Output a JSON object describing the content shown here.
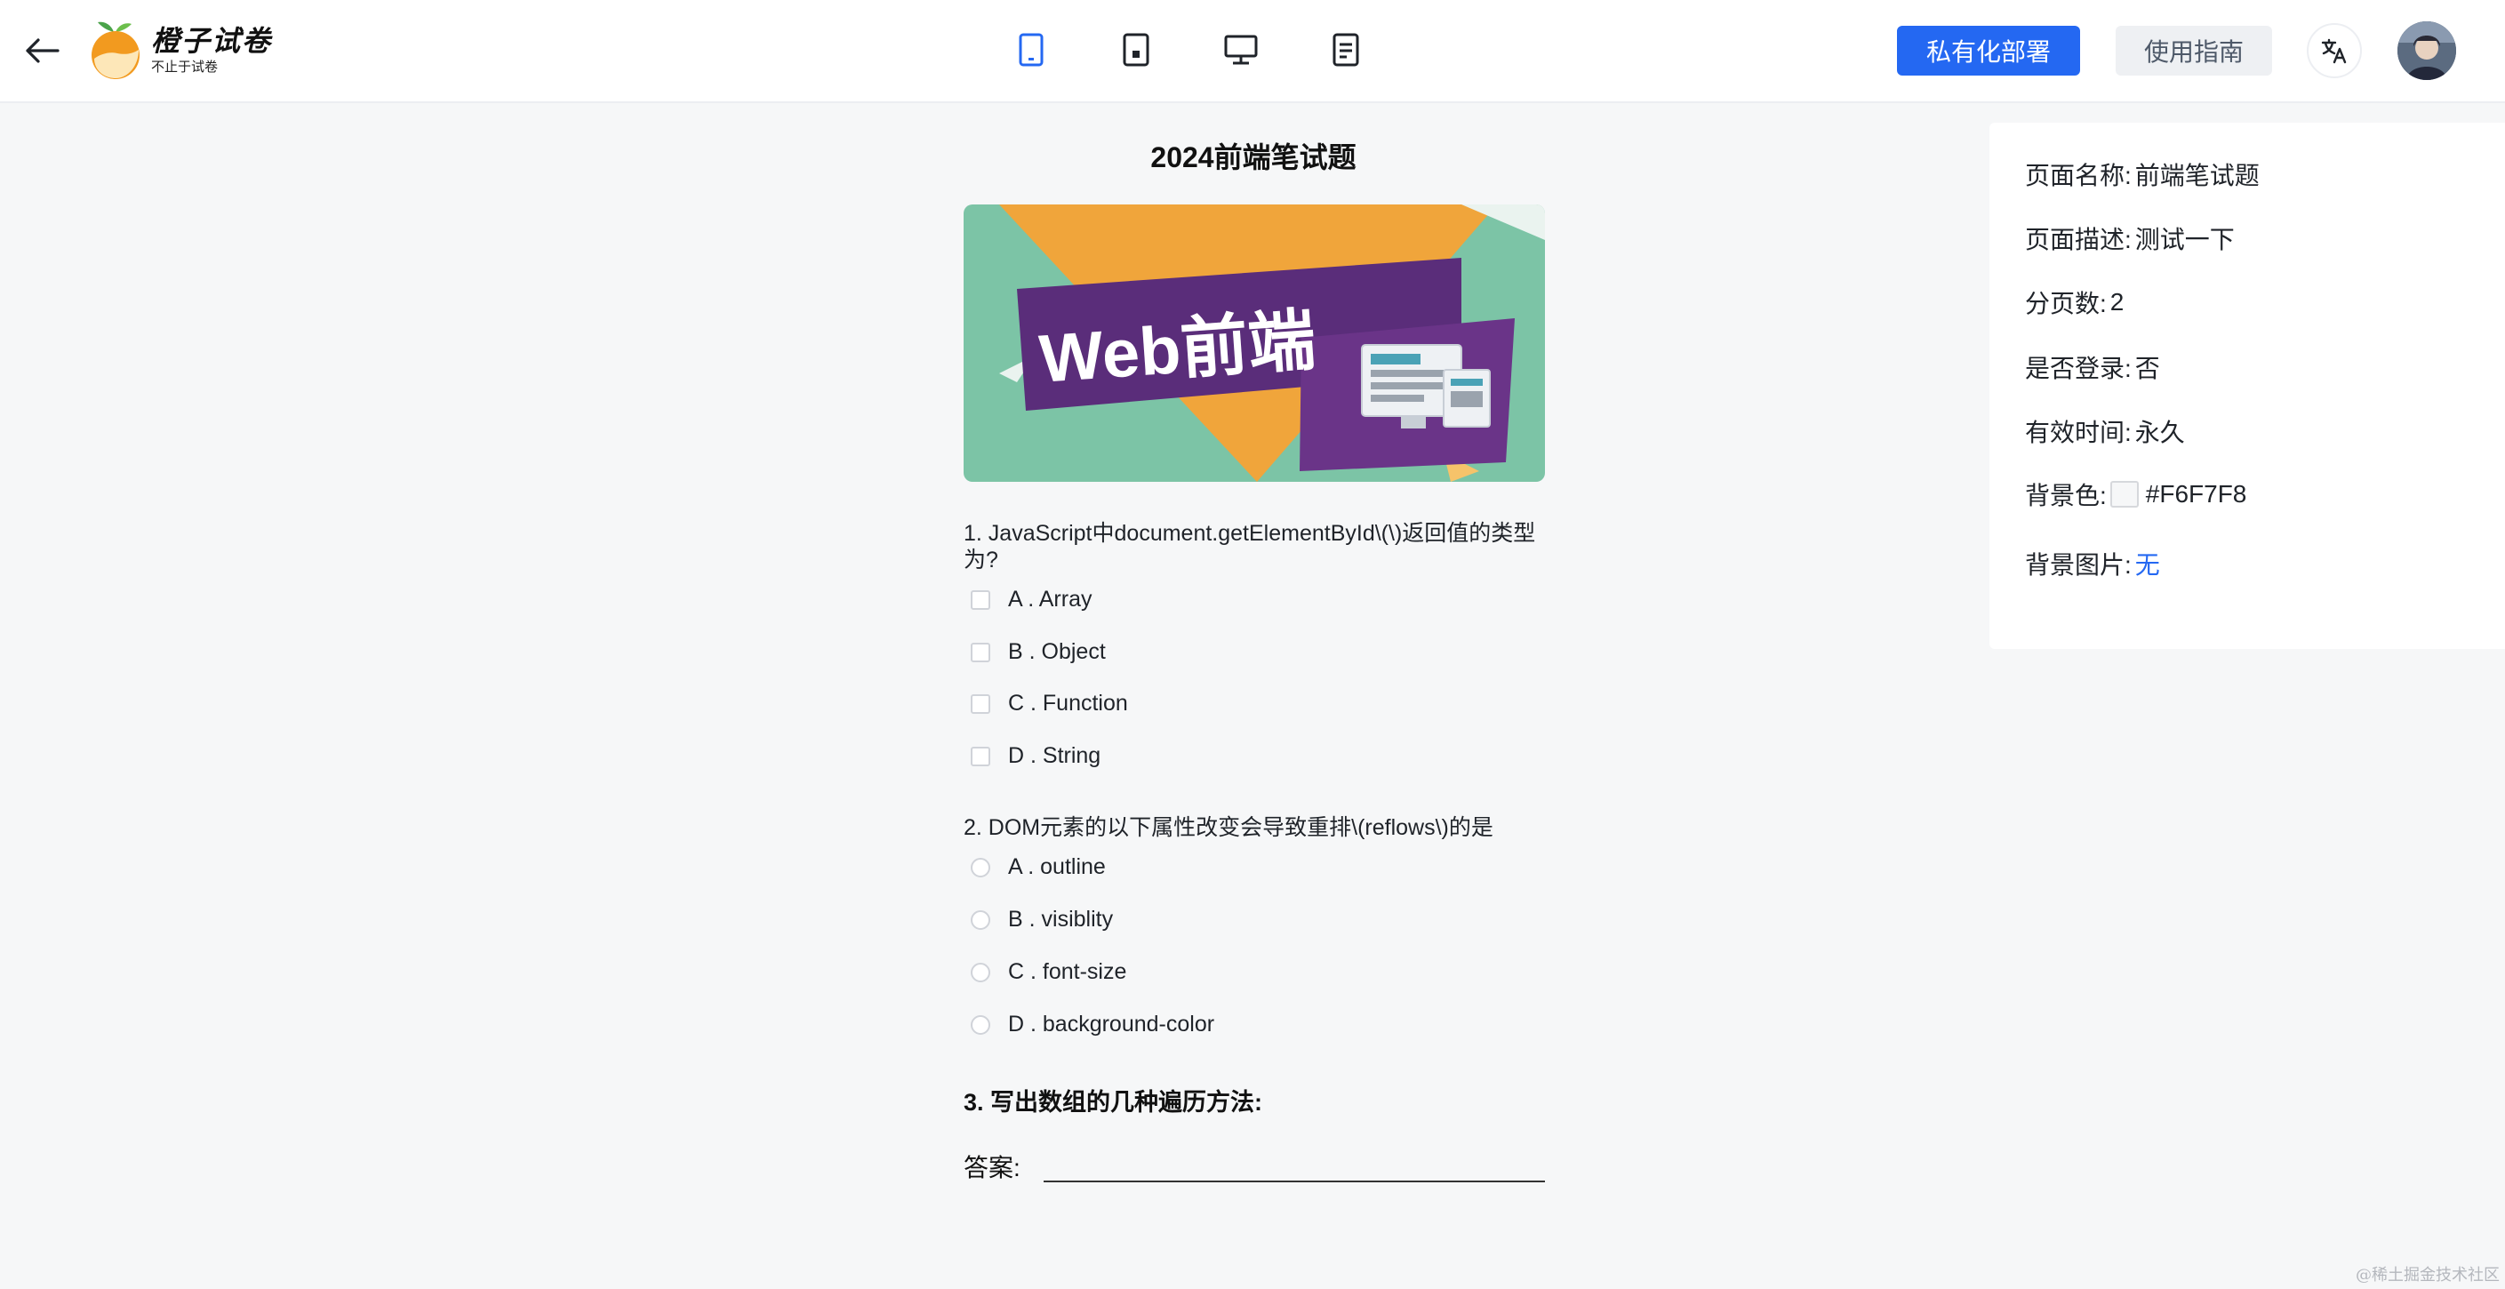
{
  "header": {
    "brand_name": "橙子试卷",
    "brand_tagline": "不止于试卷",
    "private_deploy_label": "私有化部署",
    "guide_label": "使用指南",
    "active_device": "mobile",
    "colors": {
      "primary": "#2468f2",
      "active_icon": "#2468f2"
    }
  },
  "paper": {
    "title": "2024前端笔试题",
    "banner_text": "Web前端",
    "questions": [
      {
        "text": "1. JavaScript中document.getElementById\\(\\)返回值的类型为?",
        "type": "checkbox",
        "options": [
          "A . Array",
          "B . Object",
          "C . Function",
          "D . String"
        ]
      },
      {
        "text": "2. DOM元素的以下属性改变会导致重排\\(reflows\\)的是",
        "type": "radio",
        "options": [
          "A . outline",
          "B . visiblity",
          "C . font-size",
          "D . background-color"
        ]
      },
      {
        "text": "3. 写出数组的几种遍历方法:",
        "type": "text",
        "answer_label": "答案:",
        "answer_value": ""
      }
    ]
  },
  "settings": {
    "page_name_label": "页面名称:",
    "page_name": "前端笔试题",
    "page_desc_label": "页面描述:",
    "page_desc": "测试一下",
    "page_count_label": "分页数:",
    "page_count": "2",
    "login_label": "是否登录:",
    "login": "否",
    "valid_time_label": "有效时间:",
    "valid_time": "永久",
    "bg_color_label": "背景色:",
    "bg_color": "#F6F7F8",
    "bg_image_label": "背景图片:",
    "bg_image": "无"
  },
  "watermark": "@稀土掘金技术社区"
}
